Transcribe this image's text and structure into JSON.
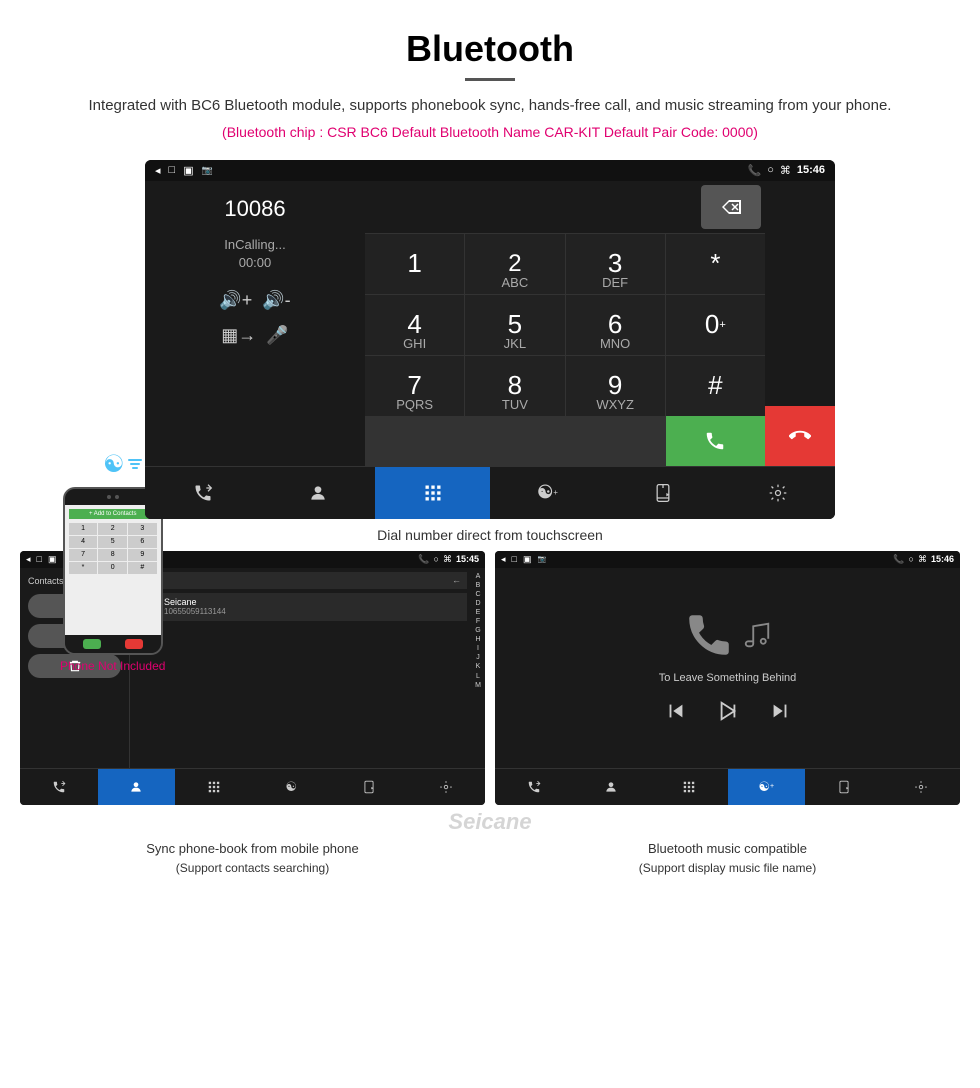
{
  "header": {
    "title": "Bluetooth",
    "description": "Integrated with BC6 Bluetooth module, supports phonebook sync, hands-free call, and music streaming from your phone.",
    "specs": "(Bluetooth chip : CSR BC6    Default Bluetooth Name CAR-KIT    Default Pair Code: 0000)"
  },
  "main_screen": {
    "status_bar": {
      "time": "15:46",
      "left_icons": [
        "back-icon",
        "window-icon",
        "square-icon",
        "sim-icon"
      ]
    },
    "dialer": {
      "number": "10086",
      "status_line1": "InCalling...",
      "status_line2": "00:00"
    },
    "keypad": {
      "keys": [
        {
          "label": "1",
          "sub": ""
        },
        {
          "label": "2",
          "sub": "ABC"
        },
        {
          "label": "3",
          "sub": "DEF"
        },
        {
          "label": "*",
          "sub": ""
        },
        {
          "label": "⌫",
          "sub": "",
          "type": "delete"
        },
        {
          "label": "4",
          "sub": "GHI"
        },
        {
          "label": "5",
          "sub": "JKL"
        },
        {
          "label": "6",
          "sub": "MNO"
        },
        {
          "label": "0+",
          "sub": ""
        },
        {
          "label": "📞",
          "sub": "",
          "type": "green"
        },
        {
          "label": "7",
          "sub": "PQRS"
        },
        {
          "label": "8",
          "sub": "TUV"
        },
        {
          "label": "9",
          "sub": "WXYZ"
        },
        {
          "label": "#",
          "sub": ""
        },
        {
          "label": "📵",
          "sub": "",
          "type": "red"
        }
      ]
    },
    "bottom_bar": {
      "buttons": [
        "call-transfer",
        "contacts",
        "keypad",
        "bluetooth",
        "phone-transfer",
        "settings"
      ],
      "active_index": 2
    }
  },
  "caption_main": "Dial number direct from touchscreen",
  "phone_illustration": {
    "label": "Phone Not Included",
    "add_to_contacts": "+ Add to Contacts"
  },
  "contacts_screen": {
    "status_bar": {
      "time": "15:45"
    },
    "contacts_num": "Contacts Num:54",
    "contact_name": "Seicane",
    "contact_number": "10655059113144",
    "actions": [
      "call",
      "sync",
      "delete"
    ],
    "alpha_list": [
      "A",
      "B",
      "C",
      "D",
      "E",
      "F",
      "G",
      "H",
      "I",
      "J",
      "K",
      "L",
      "M"
    ],
    "bottom_bar_active": 1
  },
  "music_screen": {
    "status_bar": {
      "time": "15:46"
    },
    "song_title": "To Leave Something Behind",
    "controls": [
      "prev",
      "play-pause",
      "next"
    ],
    "bottom_bar_active": 3
  },
  "bottom_captions": {
    "left": "Sync phone-book from mobile phone\n(Support contacts searching)",
    "right": "Bluetooth music compatible\n(Support display music file name)"
  },
  "watermark": "Seicane"
}
